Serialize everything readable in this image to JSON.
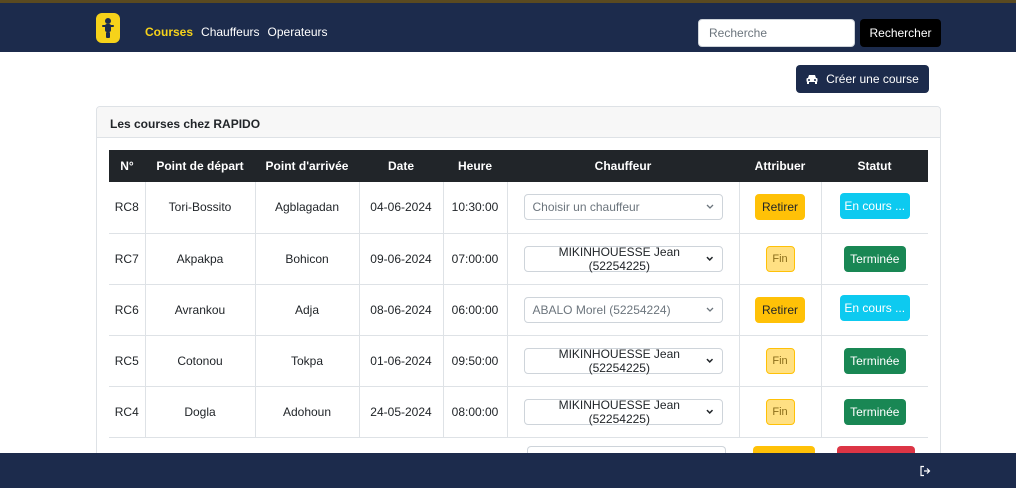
{
  "nav": {
    "logo_icon": "scooter-rider-icon",
    "items": [
      {
        "label": "Courses",
        "active": true
      },
      {
        "label": "Chauffeurs",
        "active": false
      },
      {
        "label": "Operateurs",
        "active": false
      }
    ]
  },
  "search": {
    "placeholder": "Recherche",
    "button_label": "Rechercher"
  },
  "actions": {
    "create_label": "Créer une course",
    "create_icon": "car-icon"
  },
  "card": {
    "title": "Les courses chez RAPIDO"
  },
  "table": {
    "headers": [
      "N°",
      "Point de départ",
      "Point d'arrivée",
      "Date",
      "Heure",
      "Chauffeur",
      "Attribuer",
      "Statut"
    ],
    "rows": [
      {
        "num": "RC8",
        "depart": "Tori-Bossito",
        "arrivee": "Agblagadan",
        "date": "04-06-2024",
        "heure": "10:30:00",
        "chauffeur": "Choisir un chauffeur",
        "attribuer": "Retirer",
        "statut": "En cours ..."
      },
      {
        "num": "RC7",
        "depart": "Akpakpa",
        "arrivee": "Bohicon",
        "date": "09-06-2024",
        "heure": "07:00:00",
        "chauffeur": "MIKINHOUESSE Jean (52254225)",
        "attribuer": "Fin",
        "statut": "Terminée"
      },
      {
        "num": "RC6",
        "depart": "Avrankou",
        "arrivee": "Adja",
        "date": "08-06-2024",
        "heure": "06:00:00",
        "chauffeur": "ABALO Morel (52254224)",
        "attribuer": "Retirer",
        "statut": "En cours ..."
      },
      {
        "num": "RC5",
        "depart": "Cotonou",
        "arrivee": "Tokpa",
        "date": "01-06-2024",
        "heure": "09:50:00",
        "chauffeur": "MIKINHOUESSE Jean (52254225)",
        "attribuer": "Fin",
        "statut": "Terminée"
      },
      {
        "num": "RC4",
        "depart": "Dogla",
        "arrivee": "Adohoun",
        "date": "24-05-2024",
        "heure": "08:00:00",
        "chauffeur": "MIKINHOUESSE Jean (52254225)",
        "attribuer": "Fin",
        "statut": "Terminée"
      }
    ]
  },
  "footer": {
    "logout_icon": "logout-icon"
  },
  "colors": {
    "navbar": "#1c2b4c",
    "accent": "#f6d21a",
    "warning": "#ffc107",
    "info": "#0dcaf0",
    "success": "#198754"
  }
}
